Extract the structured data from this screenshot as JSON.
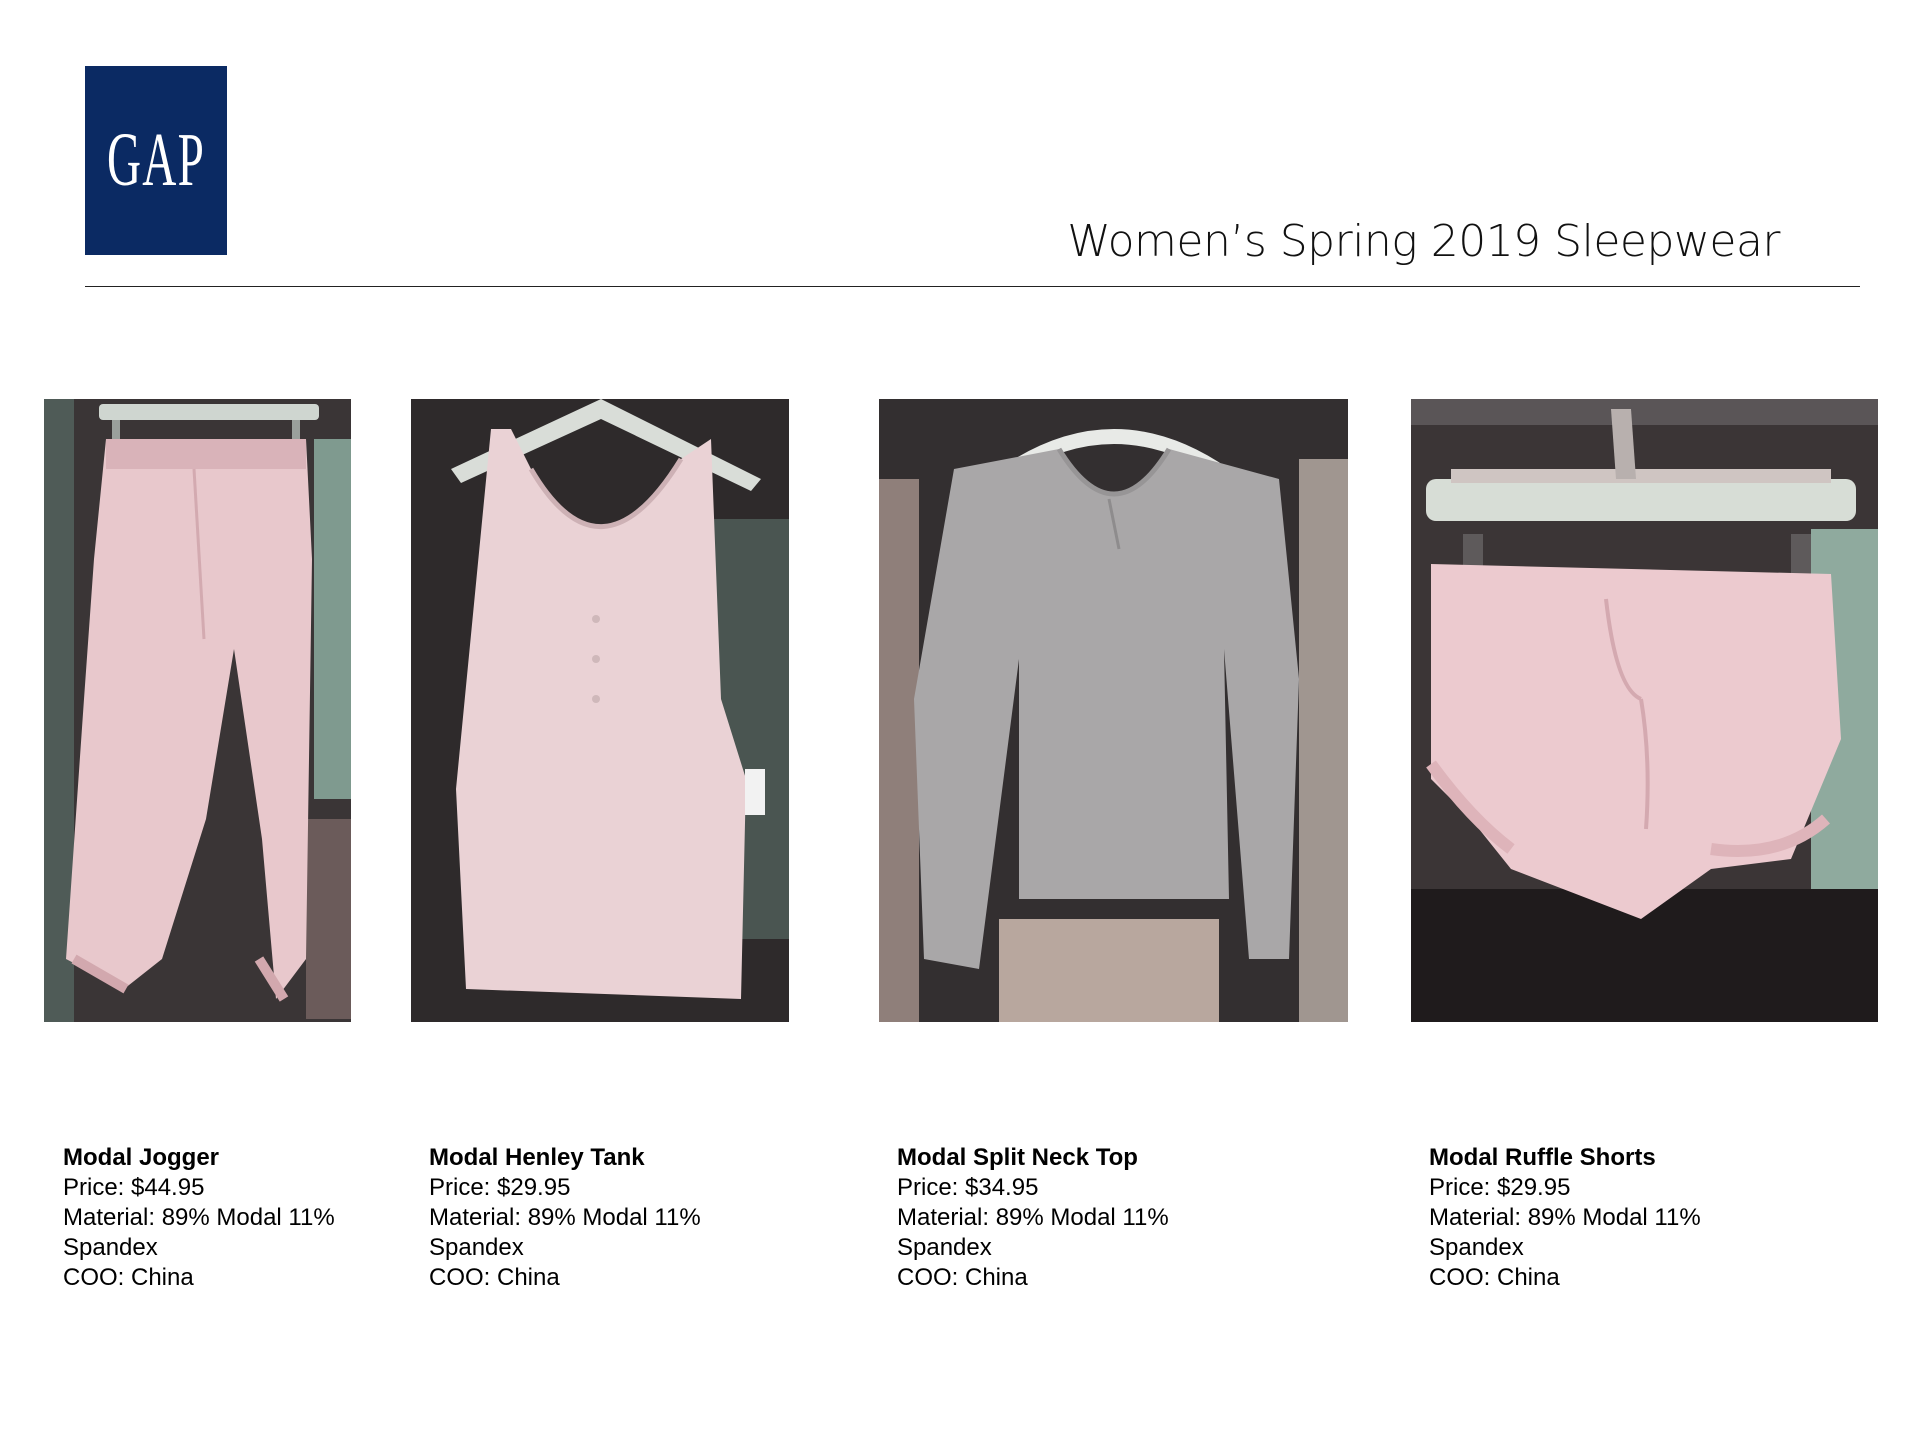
{
  "brand": {
    "logo_text": "GAP",
    "logo_color": "#0b2a63"
  },
  "title": "Women’s Spring 2019 Sleepwear",
  "products": [
    {
      "name": "Modal Jogger",
      "price": "Price: $44.95",
      "material_1": "Material: 89% Modal 11%",
      "material_2": "Spandex",
      "coo": "COO: China",
      "garment_color": "#e9c9cd"
    },
    {
      "name": "Modal Henley Tank",
      "price": "Price: $29.95",
      "material_1": "Material: 89% Modal 11%",
      "material_2": "Spandex",
      "coo": "COO: China",
      "garment_color": "#ead3d6"
    },
    {
      "name": "Modal Split Neck Top",
      "price": "Price: $34.95",
      "material_1": "Material: 89% Modal 11%",
      "material_2": "Spandex",
      "coo": "COO: China",
      "garment_color": "#a8a6a7"
    },
    {
      "name": "Modal Ruffle Shorts",
      "price": "Price: $29.95",
      "material_1": "Material: 89% Modal 11%",
      "material_2": "Spandex",
      "coo": "COO: China",
      "garment_color": "#ecc9cd"
    }
  ]
}
